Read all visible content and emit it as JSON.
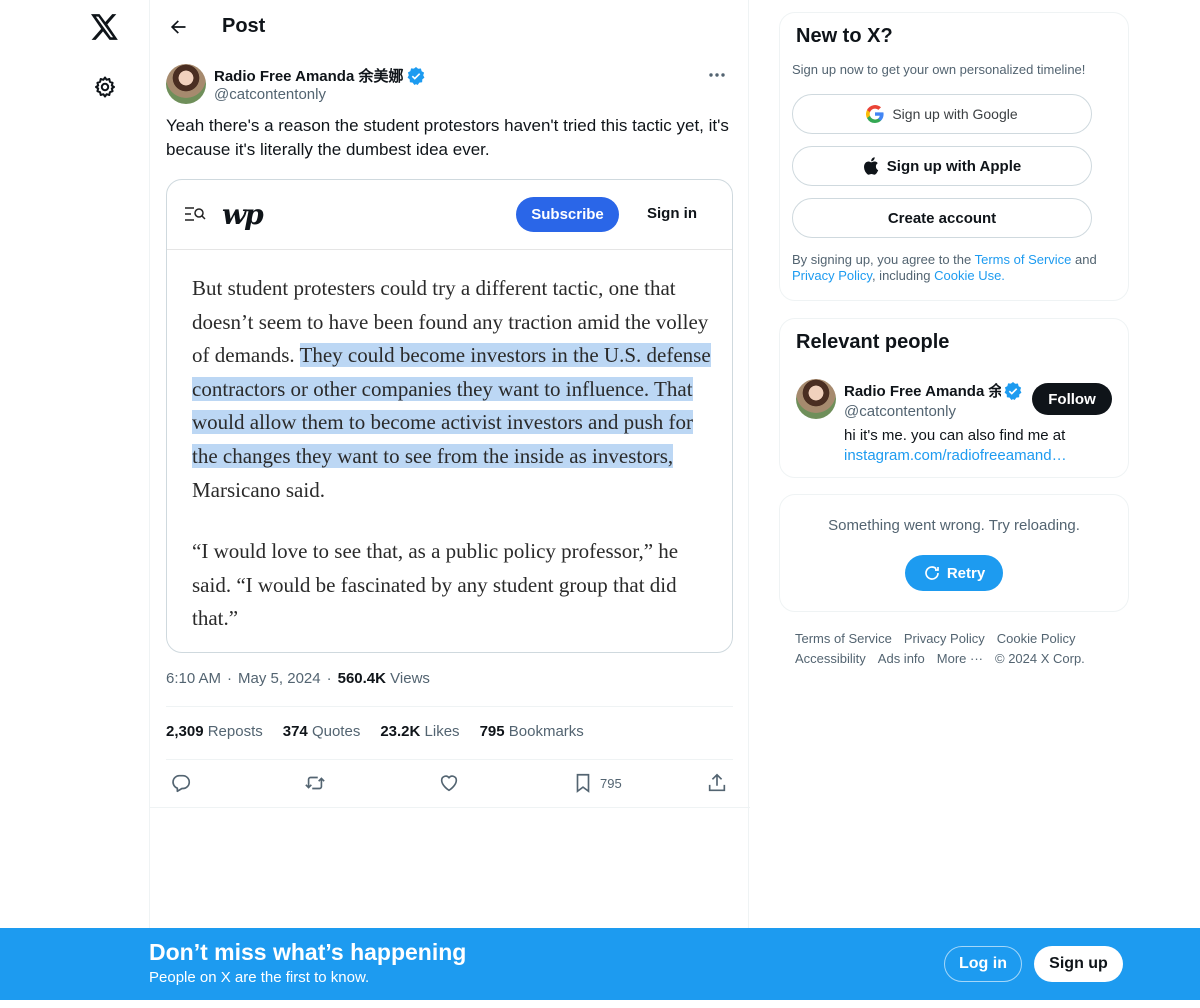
{
  "nav": {
    "logo_icon": "x-logo-icon",
    "settings_icon": "gear-icon"
  },
  "header": {
    "title": "Post",
    "back_icon": "arrow-left-icon"
  },
  "post": {
    "author_name": "Radio Free Amanda 余美娜",
    "author_handle": "@catcontentonly",
    "text": "Yeah there's a reason the student protestors haven't tried this tactic yet, it's because it's literally the dumbest idea ever.",
    "media": {
      "publisher_logo": "wp",
      "subscribe_label": "Subscribe",
      "signin_label": "Sign in",
      "para1_before": "But student protesters could try a different tactic, one that doesn’t seem to have been found any traction amid the volley of demands. ",
      "para1_highlight": "They could become investors in the U.S. defense contractors or other companies they want to influence. That would allow them to become activist investors and push for the changes they want to see from the inside as investors,",
      "para1_after": " Marsicano said.",
      "para2": "“I would love to see that, as a public policy professor,” he said. “I would be fascinated by any student group that did that.”",
      "highlight_color": "#bcd7f4"
    },
    "time": "6:10 AM",
    "date": "May 5, 2024",
    "views_count": "560.4K",
    "views_label": "Views",
    "stats": {
      "reposts_count": "2,309",
      "reposts_label": "Reposts",
      "quotes_count": "374",
      "quotes_label": "Quotes",
      "likes_count": "23.2K",
      "likes_label": "Likes",
      "bookmarks_count": "795",
      "bookmarks_label": "Bookmarks"
    },
    "actions": {
      "reply_icon": "reply-icon",
      "repost_icon": "repost-icon",
      "like_icon": "heart-icon",
      "bookmark_icon": "bookmark-icon",
      "bookmark_count": "795",
      "share_icon": "share-icon"
    }
  },
  "signup_card": {
    "title": "New to X?",
    "subtitle": "Sign up now to get your own personalized timeline!",
    "google_label": "Sign up with Google",
    "apple_label": "Sign up with Apple",
    "create_label": "Create account",
    "legal_prefix": "By signing up, you agree to the ",
    "terms_link": "Terms of Service",
    "legal_and": " and",
    "privacy_link": "Privacy Policy",
    "legal_including": ", including ",
    "cookie_link": "Cookie Use."
  },
  "relevant": {
    "title": "Relevant people",
    "name": "Radio Free Amanda 余",
    "handle": "@catcontentonly",
    "follow_label": "Follow",
    "bio": "hi it's me. you can also find me at",
    "bio_link": "instagram.com/radiofreeamand…"
  },
  "error_card": {
    "message": "Something went wrong. Try reloading.",
    "retry_label": "Retry"
  },
  "footer": {
    "links": [
      "Terms of Service",
      "Privacy Policy",
      "Cookie Policy",
      "Accessibility",
      "Ads info",
      "More ···",
      "© 2024 X Corp."
    ]
  },
  "banner": {
    "title": "Don’t miss what’s happening",
    "subtitle": "People on X are the first to know.",
    "login_label": "Log in",
    "signup_label": "Sign up",
    "color": "#1d9bf0"
  }
}
